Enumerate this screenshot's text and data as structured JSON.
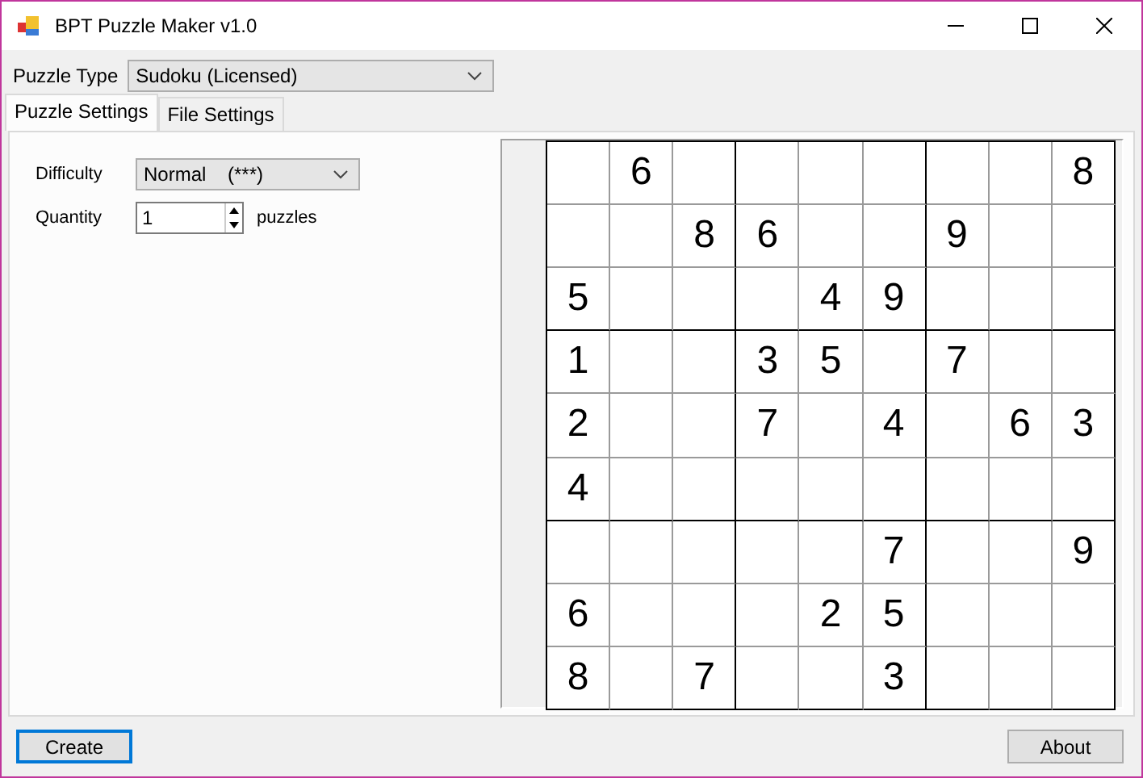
{
  "window": {
    "title": "BPT Puzzle Maker v1.0"
  },
  "puzzle_type": {
    "label": "Puzzle Type",
    "value": "Sudoku (Licensed)"
  },
  "tabs": [
    {
      "label": "Puzzle Settings",
      "selected": true
    },
    {
      "label": "File Settings",
      "selected": false
    }
  ],
  "settings": {
    "difficulty": {
      "label": "Difficulty",
      "value": "Normal    (***)"
    },
    "quantity": {
      "label": "Quantity",
      "value": "1",
      "unit": "puzzles"
    }
  },
  "grid": [
    [
      {
        "kind": "empty"
      },
      {
        "kind": "digit",
        "value": "6"
      },
      {
        "kind": "empty"
      },
      {
        "kind": "empty"
      },
      {
        "kind": "empty"
      },
      {
        "kind": "empty"
      },
      {
        "kind": "empty"
      },
      {
        "kind": "empty"
      },
      {
        "kind": "digit",
        "value": "8"
      }
    ],
    [
      {
        "kind": "empty"
      },
      {
        "kind": "empty"
      },
      {
        "kind": "digit",
        "value": "8"
      },
      {
        "kind": "digit",
        "value": "6"
      },
      {
        "kind": "empty"
      },
      {
        "kind": "empty"
      },
      {
        "kind": "digit",
        "value": "9"
      },
      {
        "kind": "empty"
      },
      {
        "kind": "empty"
      }
    ],
    [
      {
        "kind": "digit",
        "value": "5"
      },
      {
        "kind": "empty"
      },
      {
        "kind": "empty"
      },
      {
        "kind": "empty"
      },
      {
        "kind": "digit",
        "value": "4"
      },
      {
        "kind": "digit",
        "value": "9"
      },
      {
        "kind": "empty"
      },
      {
        "kind": "empty"
      },
      {
        "kind": "empty"
      }
    ],
    [
      {
        "kind": "digit",
        "value": "1"
      },
      {
        "kind": "empty"
      },
      {
        "kind": "empty"
      },
      {
        "kind": "digit",
        "value": "3"
      },
      {
        "kind": "digit",
        "value": "5"
      },
      {
        "kind": "empty"
      },
      {
        "kind": "digit",
        "value": "7"
      },
      {
        "kind": "empty"
      },
      {
        "kind": "empty"
      }
    ],
    [
      {
        "kind": "digit",
        "value": "2"
      },
      {
        "kind": "empty"
      },
      {
        "kind": "empty"
      },
      {
        "kind": "digit",
        "value": "7"
      },
      {
        "kind": "empty"
      },
      {
        "kind": "digit",
        "value": "4"
      },
      {
        "kind": "empty"
      },
      {
        "kind": "digit",
        "value": "6"
      },
      {
        "kind": "digit",
        "value": "3"
      }
    ],
    [
      {
        "kind": "digit",
        "value": "4"
      },
      {
        "kind": "empty"
      },
      {
        "kind": "empty"
      },
      {
        "kind": "empty"
      },
      {
        "kind": "empty"
      },
      {
        "kind": "empty"
      },
      {
        "kind": "empty"
      },
      {
        "kind": "empty"
      },
      {
        "kind": "empty"
      }
    ],
    [
      {
        "kind": "empty"
      },
      {
        "kind": "empty"
      },
      {
        "kind": "empty"
      },
      {
        "kind": "empty"
      },
      {
        "kind": "empty"
      },
      {
        "kind": "digit",
        "value": "7"
      },
      {
        "kind": "empty"
      },
      {
        "kind": "empty"
      },
      {
        "kind": "digit",
        "value": "9"
      }
    ],
    [
      {
        "kind": "digit",
        "value": "6"
      },
      {
        "kind": "empty"
      },
      {
        "kind": "empty"
      },
      {
        "kind": "empty"
      },
      {
        "kind": "digit",
        "value": "2"
      },
      {
        "kind": "digit",
        "value": "5"
      },
      {
        "kind": "empty"
      },
      {
        "kind": "empty"
      },
      {
        "kind": "empty"
      }
    ],
    [
      {
        "kind": "digit",
        "value": "8"
      },
      {
        "kind": "empty"
      },
      {
        "kind": "digit",
        "value": "7"
      },
      {
        "kind": "empty"
      },
      {
        "kind": "empty"
      },
      {
        "kind": "digit",
        "value": "3"
      },
      {
        "kind": "empty"
      },
      {
        "kind": "empty"
      },
      {
        "kind": "empty"
      }
    ]
  ],
  "buttons": [
    {
      "label": "Create",
      "kind": "default"
    },
    {
      "label": "About",
      "kind": "normal"
    }
  ]
}
